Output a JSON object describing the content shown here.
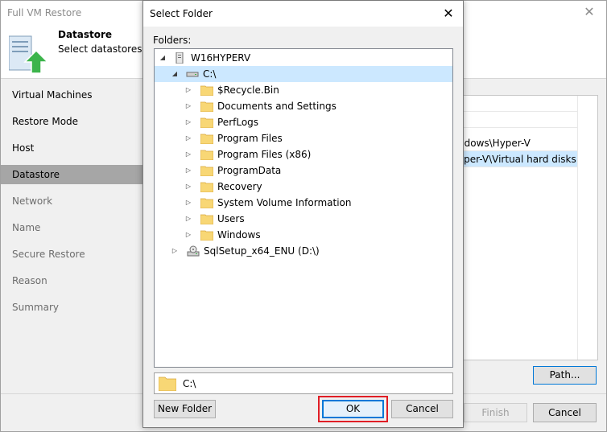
{
  "wizard": {
    "title": "Full VM Restore",
    "header_title": "Datastore",
    "header_subtitle": "Select datastores to",
    "steps": [
      {
        "label": "Virtual Machines"
      },
      {
        "label": "Restore Mode"
      },
      {
        "label": "Host"
      },
      {
        "label": "Datastore"
      },
      {
        "label": "Network"
      },
      {
        "label": "Name"
      },
      {
        "label": "Secure Restore"
      },
      {
        "label": "Reason"
      },
      {
        "label": "Summary"
      }
    ],
    "grid_rows": [
      "ndows\\Hyper-V",
      "yper-V\\Virtual hard disks"
    ],
    "path_button": "Path...",
    "finish_button": "Finish",
    "cancel_button": "Cancel"
  },
  "dialog": {
    "title": "Select Folder",
    "close_glyph": "✕",
    "folders_label": "Folders:",
    "tree": {
      "host": "W16HYPERV",
      "drive_c": "C:\\",
      "folders": [
        "$Recycle.Bin",
        "Documents and Settings",
        "PerfLogs",
        "Program Files",
        "Program Files (x86)",
        "ProgramData",
        "Recovery",
        "System Volume Information",
        "Users",
        "Windows"
      ],
      "drive_d": "SqlSetup_x64_ENU (D:\\)"
    },
    "selected_path": "C:\\",
    "new_folder_button": "New Folder",
    "ok_button": "OK",
    "cancel_button": "Cancel"
  },
  "colors": {
    "selection": "#cce8ff",
    "accent": "#0078d7",
    "highlight": "#e01e26",
    "folder": "#f8d775",
    "active_step": "#a6a6a6"
  }
}
